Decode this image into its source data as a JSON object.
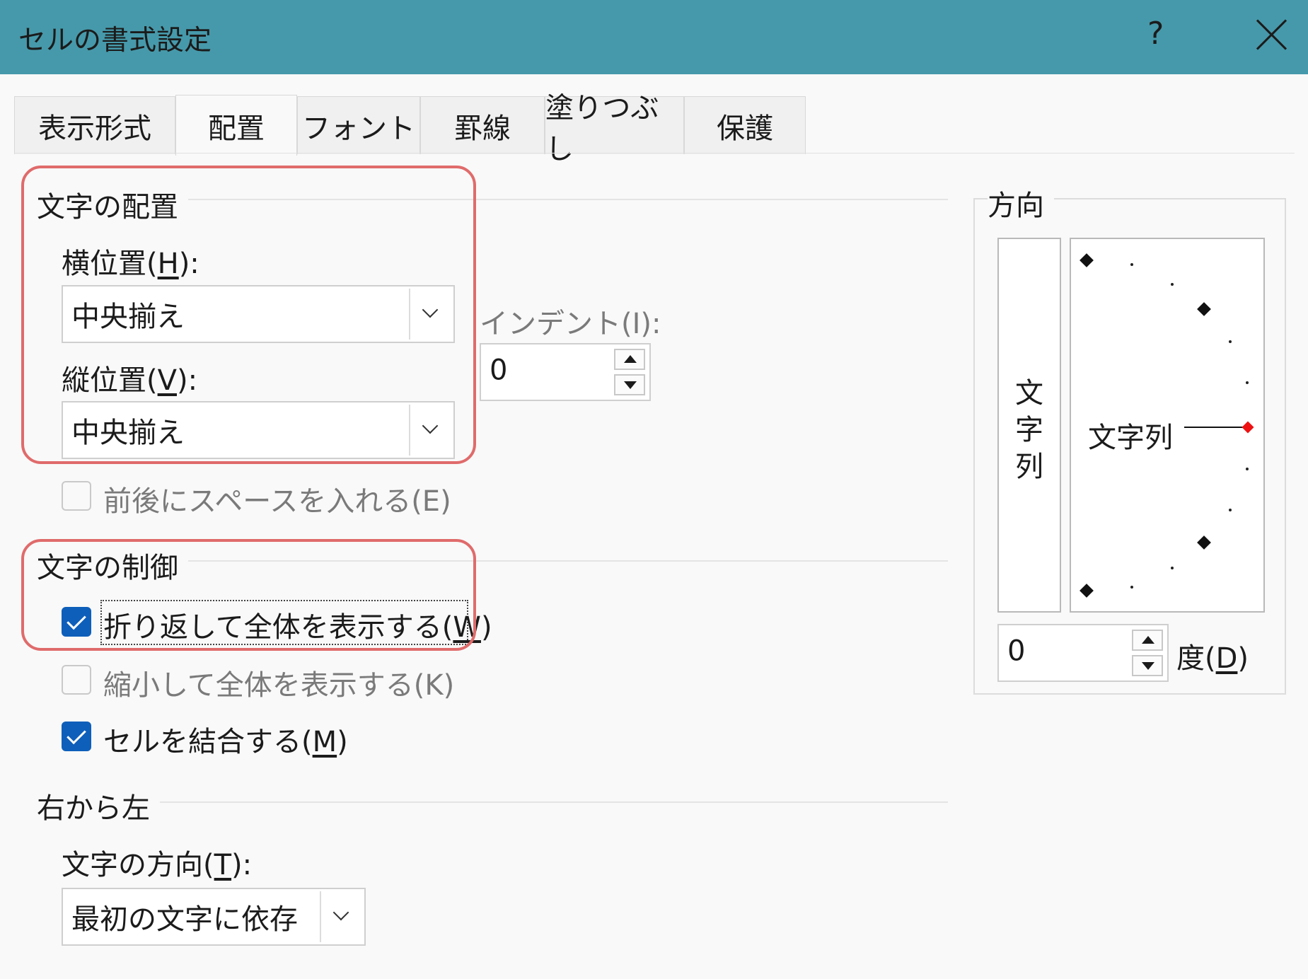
{
  "window": {
    "title": "セルの書式設定",
    "help_glyph": "?",
    "close_icon": "close-x-icon"
  },
  "tabs": [
    {
      "label": "表示形式",
      "active": false
    },
    {
      "label": "配置",
      "active": true
    },
    {
      "label": "フォント",
      "active": false
    },
    {
      "label": "罫線",
      "active": false
    },
    {
      "label": "塗りつぶし",
      "active": false
    },
    {
      "label": "保護",
      "active": false
    }
  ],
  "text_alignment": {
    "title": "文字の配置",
    "horizontal": {
      "label_pre": "横位置(",
      "key": "H",
      "label_post": "):",
      "value": "中央揃え"
    },
    "vertical": {
      "label_pre": "縦位置(",
      "key": "V",
      "label_post": "):",
      "value": "中央揃え"
    },
    "indent": {
      "label": "インデント(I):",
      "value": "0"
    },
    "distributed": {
      "label": "前後にスペースを入れる(E)",
      "checked": false,
      "enabled": false
    }
  },
  "text_control": {
    "title": "文字の制御",
    "wrap": {
      "label_pre": "折り返して全体を表示する(",
      "key": "W",
      "label_post": ")",
      "checked": true
    },
    "shrink": {
      "label": "縮小して全体を表示する(K)",
      "checked": false,
      "enabled": false
    },
    "merge": {
      "label_pre": "セルを結合する(",
      "key": "M",
      "label_post": ")",
      "checked": true
    }
  },
  "rtl": {
    "title": "右から左",
    "direction": {
      "label_pre": "文字の方向(",
      "key": "T",
      "label_post": "):",
      "value": "最初の文字に依存"
    }
  },
  "orientation": {
    "title": "方向",
    "vertical_text": [
      "文",
      "字",
      "列"
    ],
    "dial_text": "文字列",
    "degrees": {
      "value": "0",
      "label_pre": "度(",
      "key": "D",
      "label_post": ")"
    }
  },
  "colors": {
    "titlebar": "#4699aa",
    "highlight": "#e06b6b",
    "checkbox": "#0e5fba"
  }
}
